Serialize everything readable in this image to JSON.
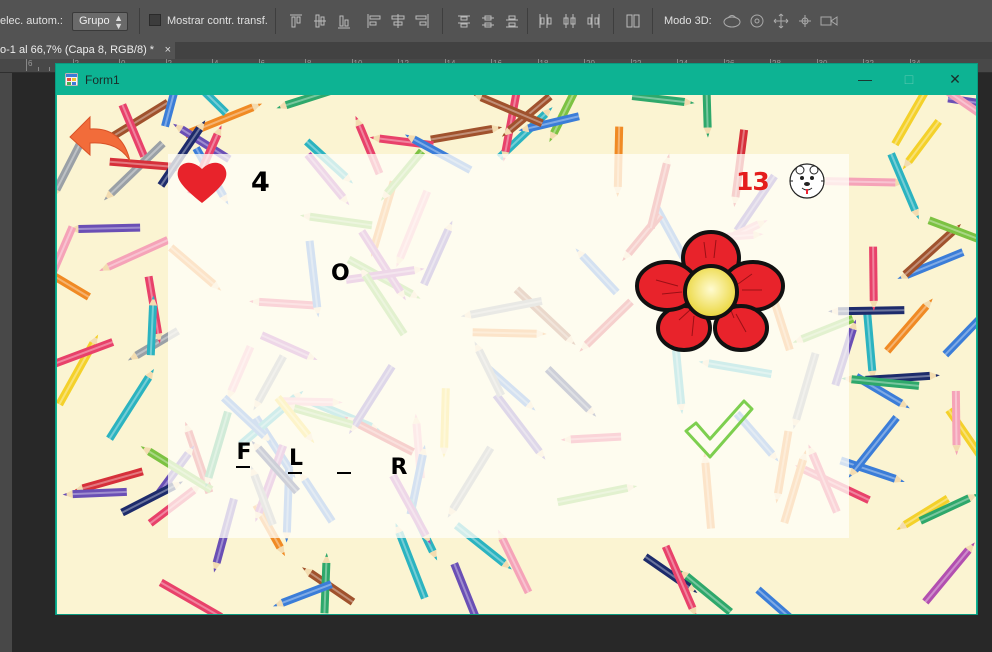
{
  "toolbar": {
    "auto_select_label": "elec. autom.:",
    "group_select": "Grupo",
    "show_transform_label": "Mostrar contr. transf.",
    "mode3d_label": "Modo 3D:"
  },
  "document_tab": {
    "title": "o-1 al 66,7% (Capa 8, RGB/8) *",
    "close": "×"
  },
  "ruler": {
    "numbers": [
      "6",
      "2",
      "0",
      "2",
      "4",
      "6",
      "8",
      "10",
      "12",
      "14",
      "16",
      "18",
      "20",
      "22",
      "24",
      "26",
      "28",
      "30",
      "32",
      "34"
    ]
  },
  "window": {
    "title": "Form1",
    "minimize": "—",
    "maximize": "□",
    "close": "✕"
  },
  "game": {
    "lives": "4",
    "score": "13",
    "hint_letter": "O",
    "slots": [
      {
        "letter": "F"
      },
      {
        "letter": "L"
      },
      {
        "letter": ""
      },
      {
        "letter": "R"
      }
    ]
  },
  "colors": {
    "title_bar": "#0db393",
    "score": "#e41d1d",
    "heart": "#e8232b",
    "back_arrow": "#f26c3a"
  },
  "icons": [
    "back-arrow-icon",
    "heart-icon",
    "clock-icon",
    "flower-icon",
    "checkmark-icon"
  ]
}
